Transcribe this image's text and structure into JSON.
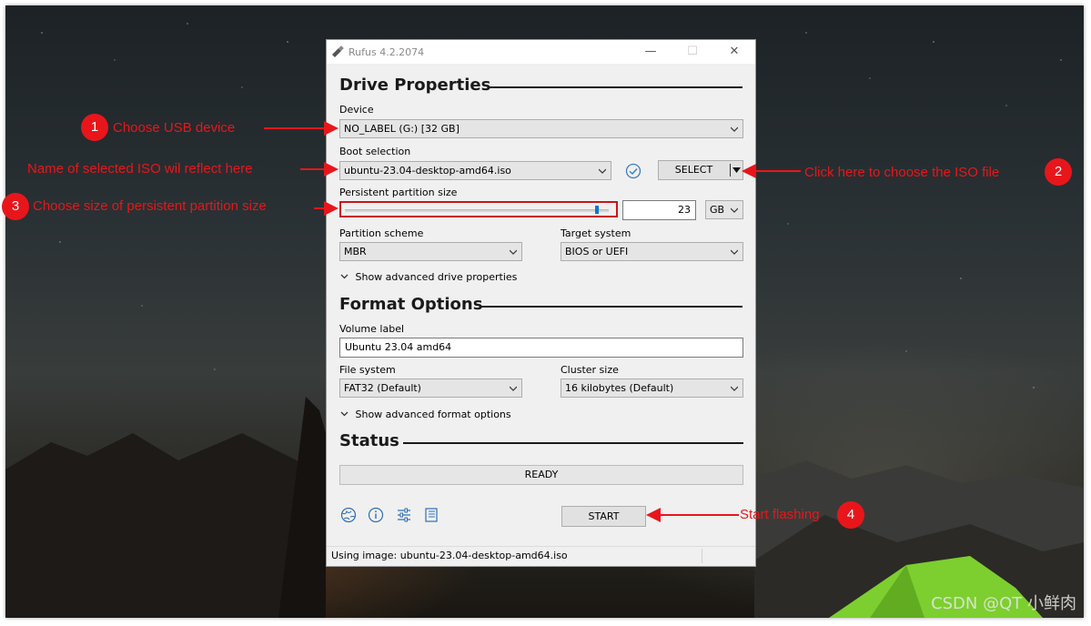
{
  "window": {
    "title": "Rufus 4.2.2074",
    "minimize": "—",
    "maximize": "☐",
    "close": "✕"
  },
  "drive": {
    "heading": "Drive Properties",
    "device_label": "Device",
    "device_value": "NO_LABEL (G:) [32 GB]",
    "boot_label": "Boot selection",
    "boot_value": "ubuntu-23.04-desktop-amd64.iso",
    "select_button": "SELECT",
    "persistent_label": "Persistent partition size",
    "persistent_value": "23",
    "persistent_unit": "GB",
    "persistent_fraction": 0.96,
    "partition_label": "Partition scheme",
    "partition_value": "MBR",
    "target_label": "Target system",
    "target_value": "BIOS or UEFI",
    "advanced": "Show advanced drive properties"
  },
  "format": {
    "heading": "Format Options",
    "volume_label": "Volume label",
    "volume_value": "Ubuntu 23.04 amd64",
    "fs_label": "File system",
    "fs_value": "FAT32 (Default)",
    "cluster_label": "Cluster size",
    "cluster_value": "16 kilobytes (Default)",
    "advanced": "Show advanced format options"
  },
  "status": {
    "heading": "Status",
    "text": "READY",
    "start_button": "START",
    "footer": "Using image: ubuntu-23.04-desktop-amd64.iso"
  },
  "annotations": [
    {
      "num": "1",
      "text": "Choose USB device"
    },
    {
      "num": "2",
      "text": "Click here to choose the ISO file"
    },
    {
      "num": "3",
      "text": "Choose size of persistent partition size"
    },
    {
      "num": "4",
      "text": "Start flashing"
    }
  ],
  "annotation_iso_name": "Name of selected ISO wil reflect here",
  "watermark": "CSDN @QT 小鲜肉",
  "colors": {
    "annotation": "#e8161b",
    "accent": "#0078d7"
  }
}
